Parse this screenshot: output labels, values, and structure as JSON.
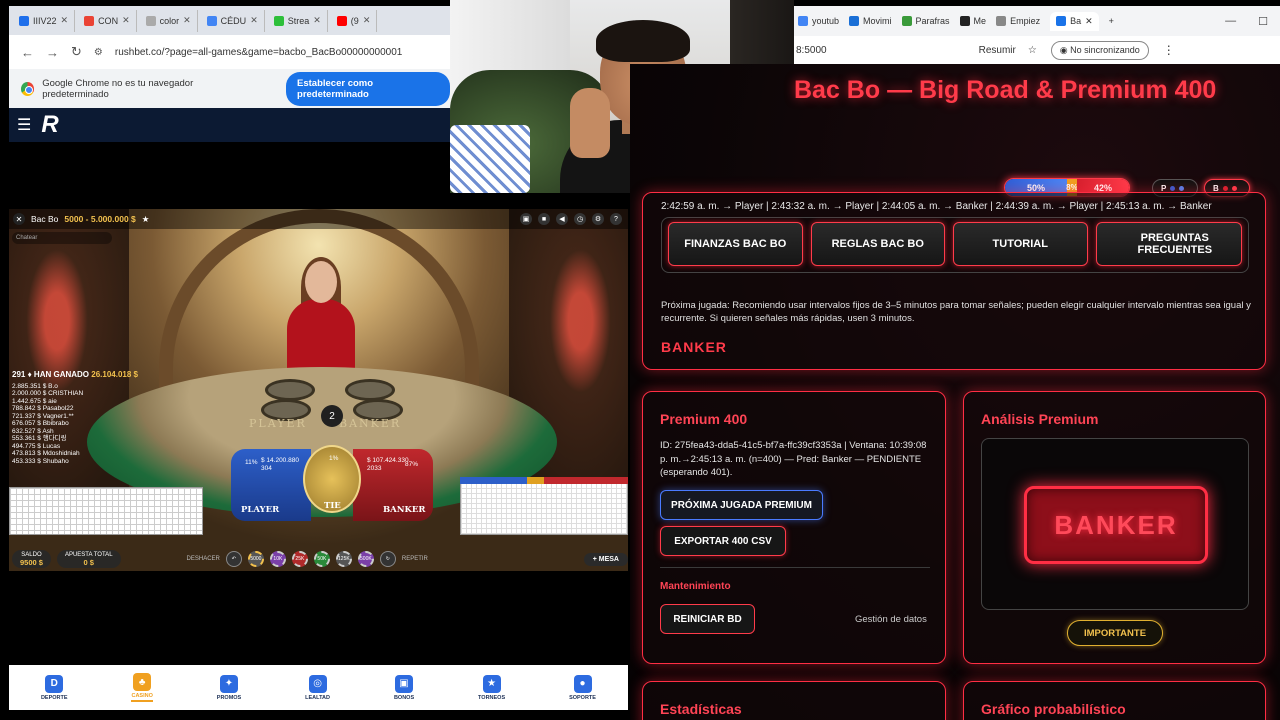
{
  "left_browser": {
    "tabs": [
      {
        "label": "IIIV22",
        "color": "#1f6feb"
      },
      {
        "label": "CON",
        "color": "#ea4335"
      },
      {
        "label": "color",
        "color": "#aaa"
      },
      {
        "label": "CÉDU",
        "color": "#4285f4"
      },
      {
        "label": "Strea",
        "color": "#2dbf3a"
      },
      {
        "label": "(9",
        "color": "#ff0000"
      }
    ],
    "url": "rushbet.co/?page=all-games&game=bacbo_BacBo00000000001",
    "infobar_text": "Google Chrome no es tu navegador predeterminado",
    "default_button": "Establecer como predeterminado"
  },
  "game": {
    "title": "Bac Bo",
    "limits": "5000 - 5.000.000 $",
    "chat_placeholder": "Chatear",
    "winners_header_count": "291",
    "winners_header_label": "HAN GANADO",
    "winners_header_amount": "26.104.018 $",
    "winners": [
      "2.885.351 $ B.o",
      "2.000.000 $ CRISTHIAN",
      "1.442.675 $ aie",
      "788.842 $ Pasabol22",
      "721.337 $ Vagner1.**",
      "676.057 $ Bbibrabo",
      "632.527 $ Ash",
      "553.361 $ 행다디링",
      "494.775 $ Lucas",
      "473.813 $ Mdoshidniah",
      "453.333 $ Shubaho"
    ],
    "round_number": "2",
    "table_player": "PLAYER",
    "table_banker": "BANKER",
    "player": {
      "label": "PLAYER",
      "pct": "11%",
      "amount": "$ 14.200.880",
      "count": "304"
    },
    "tie": {
      "label": "TIE",
      "pct": "1%"
    },
    "banker": {
      "label": "BANKER",
      "pct": "87%",
      "amount": "$ 107.424.330",
      "count": "2033"
    },
    "saldo_label": "SALDO",
    "saldo_value": "9500 $",
    "apuesta_label": "APUESTA TOTAL",
    "apuesta_value": "0 $",
    "deshacer": "DESHACER",
    "repetir": "REPETIR",
    "chips": [
      "5000",
      "10K",
      "25K",
      "50K",
      "125K",
      "500K"
    ],
    "mesa": "MESA"
  },
  "bottom_nav": [
    {
      "label": "DEPORTE",
      "icon": "D"
    },
    {
      "label": "CASINO",
      "icon": "♣"
    },
    {
      "label": "PROMOS",
      "icon": "✦"
    },
    {
      "label": "LEALTAD",
      "icon": "◎"
    },
    {
      "label": "BONOS",
      "icon": "▣"
    },
    {
      "label": "TORNEOS",
      "icon": "★"
    },
    {
      "label": "SOPORTE",
      "icon": "●"
    }
  ],
  "right_browser": {
    "tabs": [
      "youtub",
      "Movimi",
      "Parafras",
      "Me",
      "Empiez",
      "Ba"
    ],
    "url_tail": "8:5000",
    "resumir": "Resumir",
    "sync": "No sincronizando"
  },
  "app": {
    "title": "Bac Bo — Big Road & Premium 400",
    "stats": {
      "player_pct": "50%",
      "tie_pct": "8%",
      "banker_pct": "42%",
      "player": 0.5,
      "tie": 0.08,
      "banker": 0.42
    },
    "badge_p": "P",
    "badge_b": "B",
    "history": "2:42:59 a. m. → Player | 2:43:32 a. m. → Player | 2:44:05 a. m. → Banker | 2:44:39 a. m. → Player | 2:45:13 a. m. → Banker",
    "buttons": [
      "FINANZAS BAC BO",
      "REGLAS BAC BO",
      "TUTORIAL",
      "PREGUNTAS FRECUENTES"
    ],
    "proxima": "Próxima jugada: Recomiendo usar intervalos fijos de 3–5 minutos para tomar señales; pueden elegir cualquier intervalo mientras sea igual y recurrente. Si quieren señales más rápidas, usen 3 minutos.",
    "prediction": "BANKER",
    "premium": {
      "title": "Premium 400",
      "info": "ID: 275fea43-dda5-41c5-bf7a-ffc39cf3353a | Ventana: 10:39:08 p. m.→2:45:13 a. m. (n=400) — Pred: Banker — PENDIENTE (esperando 401).",
      "next_button": "PRÓXIMA JUGADA PREMIUM",
      "export_button": "EXPORTAR 400 CSV",
      "maintenance": "Mantenimiento",
      "reset_button": "REINICIAR BD",
      "data_mgmt": "Gestión de datos"
    },
    "analysis": {
      "title": "Análisis Premium",
      "result": "BANKER",
      "important": "IMPORTANTE"
    },
    "stats_title": "Estadísticas",
    "chart_title": "Gráfico probabilístico"
  }
}
